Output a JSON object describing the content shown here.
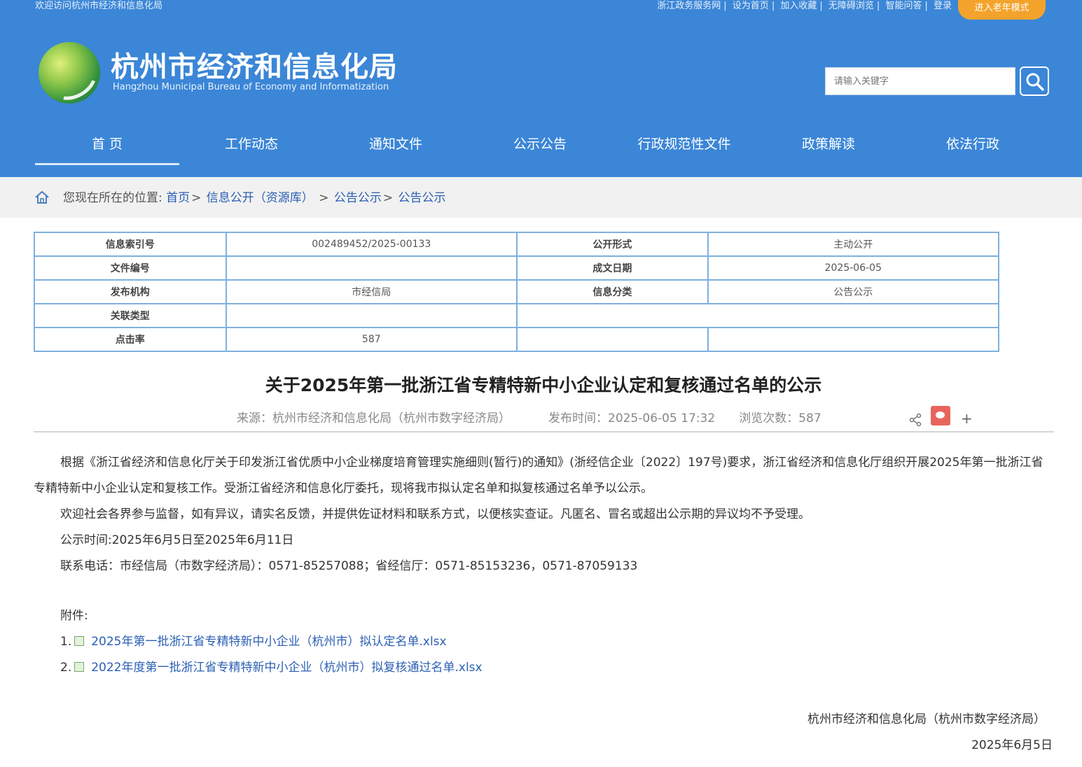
{
  "header": {
    "welcome": "欢迎访问杭州市经济和信息化局",
    "top_links": [
      "浙江政务服务网",
      "设为首页",
      "加入收藏",
      "无障碍浏览",
      "智能问答",
      "登录"
    ],
    "elder_mode": "进入老年模式",
    "site_title": "杭州市经济和信息化局",
    "site_subtitle": "Hangzhou Municipal Bureau of Economy and Informatization",
    "search_placeholder": "请输入关键字",
    "nav": [
      "首 页",
      "工作动态",
      "通知文件",
      "公示公告",
      "行政规范性文件",
      "政策解读",
      "依法行政"
    ],
    "accent_color": "#3b86d7",
    "elder_color": "#f3a32b"
  },
  "breadcrumb": {
    "prefix": "您现在所在的位置:",
    "items": [
      "首页",
      "信息公开（资源库）",
      "公告公示",
      "公告公示"
    ]
  },
  "meta": {
    "index_label": "信息索引号",
    "index_value": "002489452/2025-00133",
    "open_form_label": "公开形式",
    "open_form_value": "主动公开",
    "doc_no_label": "文件编号",
    "doc_no_value": "",
    "date_label": "成文日期",
    "date_value": "2025-06-05",
    "publisher_label": "发布机构",
    "publisher_value": "市经信局",
    "category_label": "信息分类",
    "category_value": "公告公示",
    "related_label": "关联类型",
    "related_value": "",
    "clicks_label": "点击率",
    "clicks_value": "587"
  },
  "article": {
    "title": "关于2025年第一批浙江省专精特新中小企业认定和复核通过名单的公示",
    "source": "来源：杭州市经济和信息化局（杭州市数字经济局）",
    "publish_time": "发布时间：2025-06-05 17:32",
    "views": "浏览次数：587",
    "para1": "根据《浙江省经济和信息化厅关于印发浙江省优质中小企业梯度培育管理实施细则(暂行)的通知》(浙经信企业〔2022〕197号)要求，浙江省经济和信息化厅组织开展2025年第一批浙江省专精特新中小企业认定和复核工作。受浙江省经济和信息化厅委托，现将我市拟认定名单和拟复核通过名单予以公示。",
    "para2": "欢迎社会各界参与监督，如有异议，请实名反馈，并提供佐证材料和联系方式，以便核实查证。凡匿名、冒名或超出公示期的异议均不予受理。",
    "para3": "公示时间:2025年6月5日至2025年6月11日",
    "para4": "联系电话：市经信局（市数字经济局）：0571-85257088；省经信厅：0571-85153236，0571-87059133",
    "attach_label": "附件:",
    "attachments": [
      {
        "num": "1.",
        "name": "2025年第一批浙江省专精特新中小企业（杭州市）拟认定名单.xlsx"
      },
      {
        "num": "2.",
        "name": "2022年度第一批浙江省专精特新中小企业（杭州市）拟复核通过名单.xlsx"
      }
    ],
    "sign_org": "杭州市经济和信息化局（杭州市数字经济局）",
    "sign_date": "2025年6月5日"
  }
}
